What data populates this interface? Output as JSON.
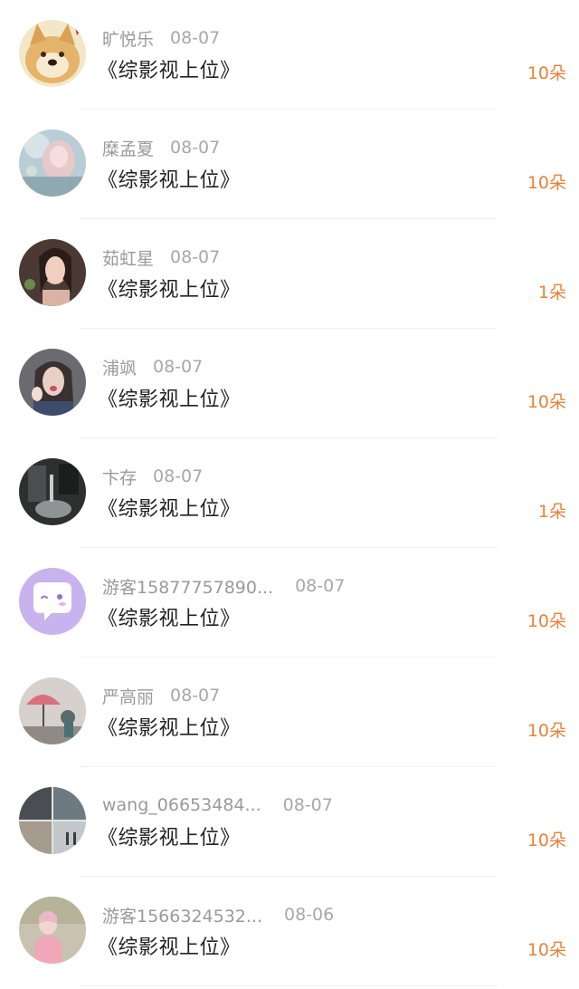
{
  "colors": {
    "accent": "#e8823a",
    "name": "#9a9a9a",
    "title": "#222222"
  },
  "records": [
    {
      "name": "旷悦乐",
      "date": "08-07",
      "title": "《综影视上位》",
      "gift": "10朵",
      "avatar_icon": "doge-avatar-icon"
    },
    {
      "name": "糜孟夏",
      "date": "08-07",
      "title": "《综影视上位》",
      "gift": "10朵",
      "avatar_icon": "anime-girl-avatar-icon"
    },
    {
      "name": "茹虹星",
      "date": "08-07",
      "title": "《综影视上位》",
      "gift": "1朵",
      "avatar_icon": "portrait-avatar-icon"
    },
    {
      "name": "浦飒",
      "date": "08-07",
      "title": "《综影视上位》",
      "gift": "10朵",
      "avatar_icon": "portrait-avatar-icon"
    },
    {
      "name": "卞存",
      "date": "08-07",
      "title": "《综影视上位》",
      "gift": "1朵",
      "avatar_icon": "dark-photo-avatar-icon"
    },
    {
      "name": "游客15877757890...",
      "date": "08-07",
      "title": "《综影视上位》",
      "gift": "10朵",
      "avatar_icon": "chat-bubble-avatar-icon"
    },
    {
      "name": "严高丽",
      "date": "08-07",
      "title": "《综影视上位》",
      "gift": "10朵",
      "avatar_icon": "umbrella-avatar-icon"
    },
    {
      "name": "wang_06653484...",
      "date": "08-07",
      "title": "《综影视上位》",
      "gift": "10朵",
      "avatar_icon": "collage-avatar-icon"
    },
    {
      "name": "游客1566324532...",
      "date": "08-06",
      "title": "《综影视上位》",
      "gift": "10朵",
      "avatar_icon": "girl-pink-avatar-icon"
    }
  ]
}
